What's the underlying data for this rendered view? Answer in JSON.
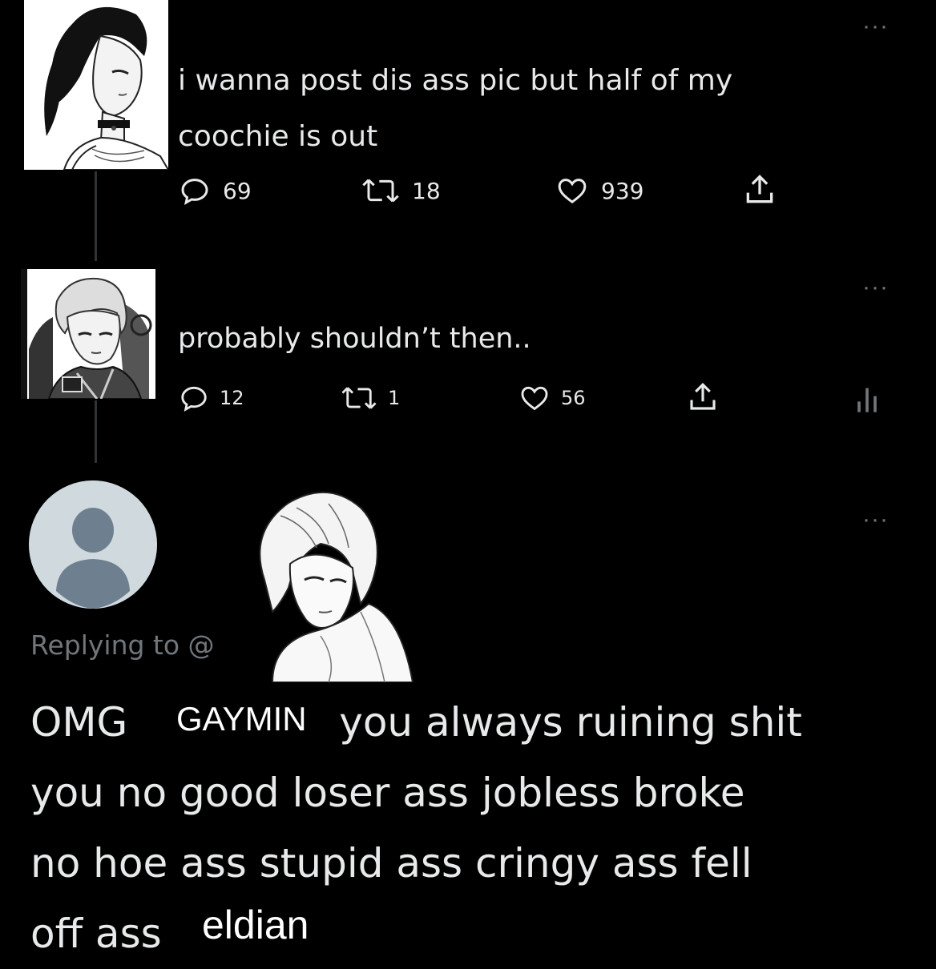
{
  "tweet1": {
    "text_line1": "i wanna post dis ass pic but half of my",
    "text_line2": "coochie is out",
    "replies": "69",
    "retweets": "18",
    "likes": "939",
    "more": "···"
  },
  "tweet2": {
    "text": "probably shouldn’t then..",
    "replies": "12",
    "retweets": "1",
    "likes": "56",
    "more": "···"
  },
  "tweet3": {
    "replying_to": "Replying to @",
    "more": "···",
    "name_label": "GAYMIN",
    "body_line1_prefix": "OMG",
    "body_line1_suffix": "you always ruining shit",
    "body_line2": "you no good loser ass jobless broke",
    "body_line3": "no hoe ass stupid ass cringy ass fell",
    "body_line4_prefix": "off ass",
    "end_label": "eldian"
  },
  "colors": {
    "background": "#000000",
    "text": "#e7e9ea",
    "muted": "#71767b",
    "default_avatar_bg": "#cfd9de",
    "default_avatar_fg": "#6e7f8f"
  },
  "icons": [
    "reply-icon",
    "retweet-icon",
    "like-icon",
    "share-icon",
    "analytics-icon",
    "more-icon"
  ]
}
